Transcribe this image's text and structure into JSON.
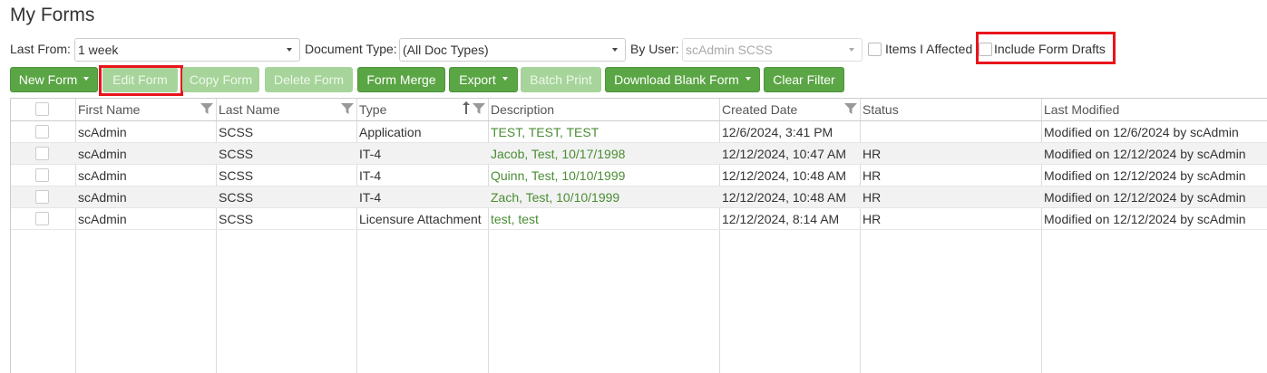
{
  "title": "My Forms",
  "filters": {
    "last_from_label": "Last From:",
    "last_from_value": "1 week",
    "doc_type_label": "Document Type:",
    "doc_type_value": "(All Doc Types)",
    "by_user_label": "By User:",
    "by_user_value": "scAdmin SCSS",
    "items_affected_label": "Items I Affected",
    "include_drafts_label": "Include Form Drafts"
  },
  "toolbar": {
    "new_form": "New Form",
    "edit_form": "Edit Form",
    "copy_form": "Copy Form",
    "delete_form": "Delete Form",
    "form_merge": "Form Merge",
    "export": "Export",
    "batch_print": "Batch Print",
    "download_blank_form": "Download Blank Form",
    "clear_filter": "Clear Filter"
  },
  "columns": [
    "First Name",
    "Last Name",
    "Type",
    "Description",
    "Created Date",
    "Status",
    "Last Modified"
  ],
  "rows": [
    {
      "first": "scAdmin",
      "last": "SCSS",
      "type": "Application",
      "description": "TEST, TEST, TEST",
      "created": "12/6/2024, 3:41 PM",
      "status": "",
      "modified": "Modified on 12/6/2024 by scAdmin"
    },
    {
      "first": "scAdmin",
      "last": "SCSS",
      "type": "IT-4",
      "description": "Jacob, Test, 10/17/1998",
      "created": "12/12/2024, 10:47 AM",
      "status": "HR",
      "modified": "Modified on 12/12/2024 by scAdmin"
    },
    {
      "first": "scAdmin",
      "last": "SCSS",
      "type": "IT-4",
      "description": "Quinn, Test, 10/10/1999",
      "created": "12/12/2024, 10:48 AM",
      "status": "HR",
      "modified": "Modified on 12/12/2024 by scAdmin"
    },
    {
      "first": "scAdmin",
      "last": "SCSS",
      "type": "IT-4",
      "description": "Zach, Test, 10/10/1999",
      "created": "12/12/2024, 10:48 AM",
      "status": "HR",
      "modified": "Modified on 12/12/2024 by scAdmin"
    },
    {
      "first": "scAdmin",
      "last": "SCSS",
      "type": "Licensure Attachment",
      "description": "test, test",
      "created": "12/12/2024, 8:14 AM",
      "status": "HR",
      "modified": "Modified on 12/12/2024 by scAdmin"
    }
  ],
  "colors": {
    "button_green": "#5aa544",
    "button_disabled": "#a6d49a",
    "link_green": "#4a8d34",
    "highlight_red": "#e8141b"
  }
}
